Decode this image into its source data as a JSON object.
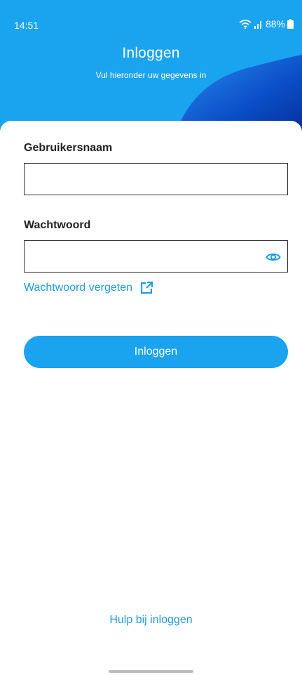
{
  "status_bar": {
    "time": "14:51",
    "battery": "88%",
    "icons": [
      "wifi-icon",
      "signal-icon",
      "battery-icon"
    ]
  },
  "header": {
    "title": "Inloggen",
    "subtitle": "Vul hieronder uw gegevens in"
  },
  "form": {
    "username_label": "Gebruikersnaam",
    "username_value": "",
    "password_label": "Wachtwoord",
    "password_value": "",
    "forgot_password": "Wachtwoord vergeten",
    "submit_label": "Inloggen"
  },
  "footer": {
    "help_link": "Hulp bij inloggen"
  },
  "colors": {
    "primary": "#1AA3EE",
    "link": "#1E9BE0",
    "header_dark": "#0A3FB0"
  }
}
